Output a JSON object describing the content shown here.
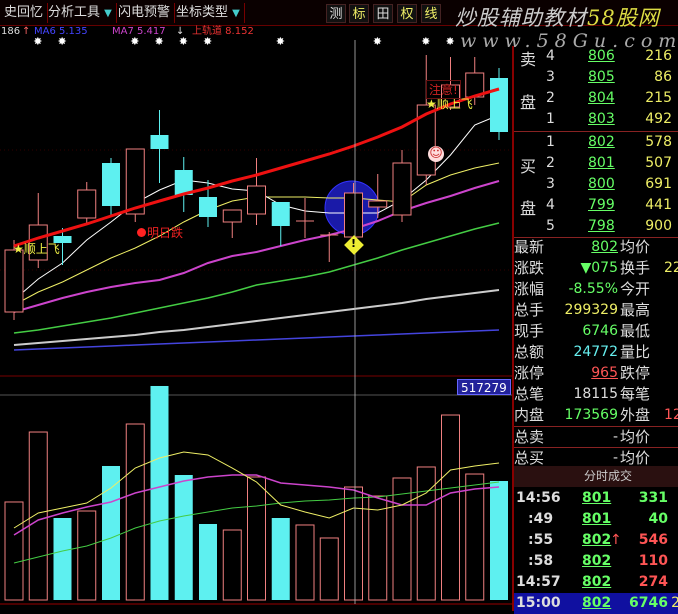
{
  "toolbar": {
    "items": [
      "史回忆",
      "分析工具",
      "闪电预警",
      "坐标类型"
    ],
    "dropdown_glyph": "▼",
    "buttons": [
      "测",
      "标",
      "田",
      "权",
      "线"
    ]
  },
  "watermark": {
    "title_a": "炒股辅助教材",
    "title_b": "58股网",
    "url": "www.58Gu.com"
  },
  "indicator_bar": {
    "count": "186",
    "up_arrow": "↑",
    "ma_a": "MA6  5.135",
    "ma_b": "MA7  5.417",
    "down_arrow": "↓",
    "upper_rail": "上轨道  8.152"
  },
  "annotations": {
    "signal_1": "顺上飞",
    "signal_2": "顺上飞",
    "warning": "注意!",
    "forecast": "明日跌",
    "star": "★",
    "diamond": "!",
    "smiley": "☺"
  },
  "colors": {
    "up": "#f08080",
    "down": "#5ef0f0",
    "rail": "#ee1111",
    "ma5": "#ffffff",
    "ma10": "#eeee66",
    "ma20": "#cc44cc",
    "ma30": "#44cc44",
    "ma60": "#cccccc",
    "ma120": "#4444dd"
  },
  "order_book": {
    "sell_label": [
      "卖",
      "盘"
    ],
    "buy_label": [
      "买",
      "盘"
    ],
    "sell": [
      {
        "level": "4",
        "price": "806",
        "vol": "216"
      },
      {
        "level": "3",
        "price": "805",
        "vol": "86"
      },
      {
        "level": "2",
        "price": "804",
        "vol": "215"
      },
      {
        "level": "1",
        "price": "803",
        "vol": "492"
      }
    ],
    "buy": [
      {
        "level": "1",
        "price": "802",
        "vol": "578"
      },
      {
        "level": "2",
        "price": "801",
        "vol": "507"
      },
      {
        "level": "3",
        "price": "800",
        "vol": "691"
      },
      {
        "level": "4",
        "price": "799",
        "vol": "441"
      },
      {
        "level": "5",
        "price": "798",
        "vol": "900"
      }
    ]
  },
  "quote": [
    {
      "label": "最新",
      "value": "802",
      "label2": "均价",
      "value2": ""
    },
    {
      "label": "涨跌",
      "value": "▼075",
      "label2": "换手",
      "value2": "22"
    },
    {
      "label": "涨幅",
      "value": "-8.55%",
      "label2": "今开",
      "value2": ""
    },
    {
      "label": "总手",
      "value": "299329",
      "label2": "最高",
      "value2": ""
    },
    {
      "label": "现手",
      "value": "6746",
      "label2": "最低",
      "value2": ""
    },
    {
      "label": "总额",
      "value": "24772",
      "label2": "量比",
      "value2": ""
    },
    {
      "label": "涨停",
      "value": "965",
      "label2": "跌停",
      "value2": ""
    },
    {
      "label": "总笔",
      "value": "18115",
      "label2": "每笔",
      "value2": ""
    },
    {
      "label": "内盘",
      "value": "173569",
      "label2": "外盘",
      "value2": "12"
    },
    {
      "label": "总卖",
      "value": "-",
      "label2": "均价",
      "value2": ""
    },
    {
      "label": "总买",
      "value": "-",
      "label2": "均价",
      "value2": ""
    }
  ],
  "ticks": {
    "header": "分时成交",
    "rows": [
      {
        "time": "14:56",
        "price": "801",
        "arrow": "",
        "vol": "331",
        "dir": "down"
      },
      {
        "time": ":49",
        "price": "801",
        "arrow": "",
        "vol": "40",
        "dir": "down"
      },
      {
        "time": ":55",
        "price": "802",
        "arrow": "↑",
        "vol": "546",
        "dir": "up"
      },
      {
        "time": ":58",
        "price": "802",
        "arrow": "",
        "vol": "110",
        "dir": "up"
      },
      {
        "time": "14:57",
        "price": "802",
        "arrow": "",
        "vol": "274",
        "dir": "up"
      },
      {
        "time": "15:00",
        "price": "802",
        "arrow": "",
        "vol": "6746",
        "extra": "2",
        "dir": "down"
      }
    ]
  },
  "chart_data": {
    "type": "candlestick",
    "price_range": [
      5.64,
      8.94
    ],
    "volume_max_label": "517279",
    "candles": [
      {
        "o": 6.22,
        "c": 6.84,
        "h": 6.94,
        "l": 6.14
      },
      {
        "o": 6.74,
        "c": 7.09,
        "h": 7.41,
        "l": 6.66
      },
      {
        "o": 6.98,
        "c": 6.91,
        "h": 7.06,
        "l": 6.69
      },
      {
        "o": 7.16,
        "c": 7.44,
        "h": 7.52,
        "l": 7.09
      },
      {
        "o": 7.71,
        "c": 7.28,
        "h": 7.76,
        "l": 7.19
      },
      {
        "o": 7.2,
        "c": 7.85,
        "h": 7.85,
        "l": 7.12
      },
      {
        "o": 7.99,
        "c": 7.85,
        "h": 8.24,
        "l": 7.51
      },
      {
        "o": 7.64,
        "c": 7.39,
        "h": 7.77,
        "l": 7.22
      },
      {
        "o": 7.37,
        "c": 7.17,
        "h": 7.54,
        "l": 7.07
      },
      {
        "o": 7.12,
        "c": 7.24,
        "h": 7.24,
        "l": 6.96
      },
      {
        "o": 7.2,
        "c": 7.48,
        "h": 7.76,
        "l": 7.09
      },
      {
        "o": 7.32,
        "c": 7.08,
        "h": 7.32,
        "l": 6.88
      },
      {
        "o": 7.13,
        "c": 7.13,
        "h": 7.36,
        "l": 6.96
      },
      {
        "o": 6.99,
        "c": 6.99,
        "h": 7.02,
        "l": 6.72
      },
      {
        "o": 6.97,
        "c": 7.41,
        "h": 7.51,
        "l": 6.89
      },
      {
        "o": 7.27,
        "c": 7.33,
        "h": 7.6,
        "l": 7.16
      },
      {
        "o": 7.19,
        "c": 7.71,
        "h": 7.84,
        "l": 7.12
      },
      {
        "o": 7.59,
        "c": 8.29,
        "h": 8.79,
        "l": 7.49
      },
      {
        "o": 8.27,
        "c": 8.49,
        "h": 8.77,
        "l": 8.24
      },
      {
        "o": 8.37,
        "c": 8.61,
        "h": 8.77,
        "l": 8.29
      },
      {
        "o": 8.56,
        "c": 8.02,
        "h": 8.66,
        "l": 7.94
      }
    ],
    "lines": {
      "rail": [
        6.88,
        6.96,
        7.03,
        7.1,
        7.18,
        7.26,
        7.33,
        7.4,
        7.46,
        7.53,
        7.59,
        7.66,
        7.73,
        7.8,
        7.88,
        7.97,
        8.07,
        8.2,
        8.3,
        8.38,
        8.45
      ],
      "ma5": [
        6.34,
        6.55,
        6.71,
        6.94,
        7.12,
        7.31,
        7.44,
        7.54,
        7.51,
        7.45,
        7.43,
        7.29,
        7.23,
        7.21,
        7.21,
        7.21,
        7.34,
        7.54,
        7.79,
        8.09,
        8.19
      ],
      "ma10": [
        6.29,
        6.42,
        6.52,
        6.64,
        6.76,
        6.86,
        6.98,
        7.12,
        7.24,
        7.33,
        7.37,
        7.37,
        7.37,
        7.36,
        7.36,
        7.34,
        7.32,
        7.49,
        7.59,
        7.66,
        7.71
      ],
      "ma20": [
        6.22,
        6.29,
        6.36,
        6.42,
        6.47,
        6.51,
        6.54,
        6.61,
        6.71,
        6.78,
        6.82,
        6.88,
        6.94,
        6.99,
        7.05,
        7.13,
        7.23,
        7.31,
        7.38,
        7.46,
        7.53
      ],
      "ma30": [
        6.01,
        6.04,
        6.08,
        6.12,
        6.16,
        6.21,
        6.26,
        6.31,
        6.36,
        6.42,
        6.49,
        6.53,
        6.57,
        6.62,
        6.69,
        6.76,
        6.84,
        6.91,
        6.98,
        7.05,
        7.11
      ],
      "ma60": [
        5.89,
        5.91,
        5.93,
        5.95,
        5.97,
        5.99,
        6.02,
        6.04,
        6.07,
        6.1,
        6.13,
        6.16,
        6.19,
        6.22,
        6.25,
        6.28,
        6.31,
        6.35,
        6.38,
        6.41,
        6.44
      ],
      "ma120": [
        5.84,
        5.85,
        5.86,
        5.87,
        5.88,
        5.89,
        5.9,
        5.91,
        5.92,
        5.93,
        5.94,
        5.95,
        5.96,
        5.97,
        5.98,
        5.99,
        6.0,
        6.01,
        6.02,
        6.03,
        6.04
      ]
    },
    "volume": [
      236900,
      406000,
      198200,
      215100,
      323900,
      425400,
      517279,
      302100,
      183700,
      169200,
      297300,
      198200,
      181300,
      149900,
      273100,
      251400,
      294900,
      321500,
      447100,
      304500,
      287600
    ],
    "volume_lines": {
      "vma5": [
        174000,
        210300,
        222400,
        234400,
        270700,
        319000,
        343200,
        357700,
        350500,
        319000,
        285200,
        229600,
        212700,
        198200,
        222400,
        217500,
        229600,
        258600,
        314200,
        323900,
        331100
      ],
      "vma10": [
        157100,
        193400,
        210300,
        224800,
        236900,
        258600,
        273100,
        287600,
        297300,
        302100,
        302100,
        282800,
        278000,
        273100,
        265900,
        246500,
        229600,
        229600,
        258600,
        268300,
        273100
      ],
      "vma20": [
        89400,
        103900,
        118400,
        130500,
        149900,
        174000,
        190900,
        203000,
        212700,
        222400,
        227200,
        234400,
        239300,
        241700,
        246500,
        249000,
        256200,
        263500,
        270700,
        278000,
        285200
      ]
    },
    "signal_days": [
      1,
      2,
      5,
      6,
      7,
      8,
      11,
      15,
      17,
      18
    ]
  }
}
